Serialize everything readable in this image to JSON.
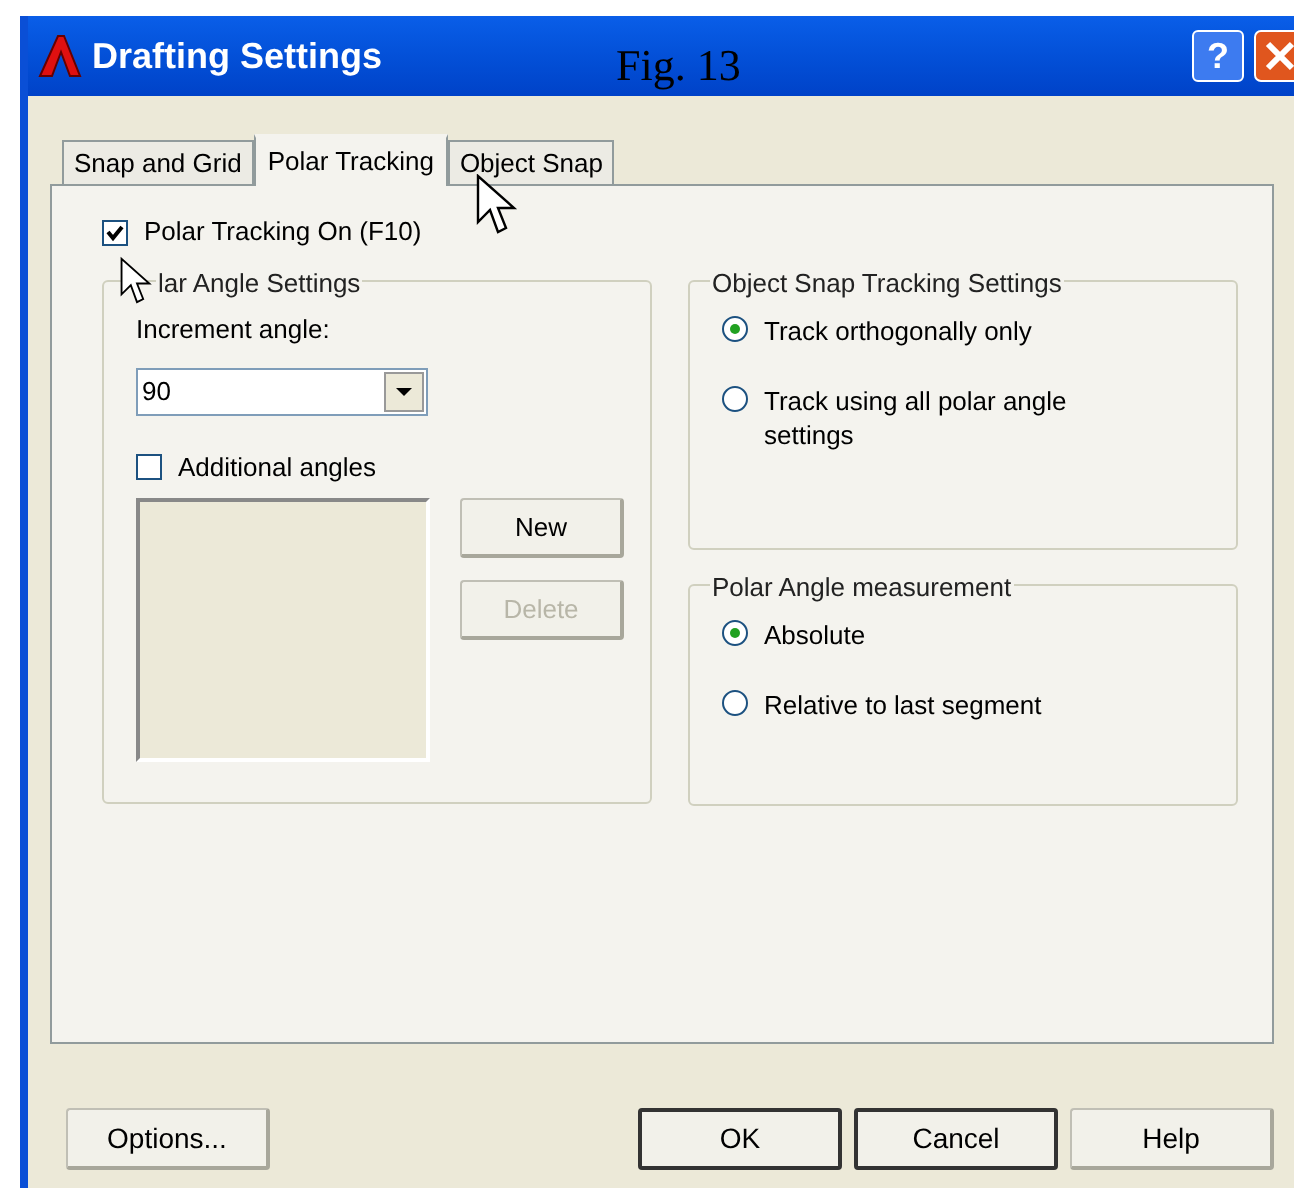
{
  "window": {
    "title": "Drafting Settings",
    "caption": "Fig. 13",
    "help_label": "?"
  },
  "tabs": [
    {
      "label": "Snap and Grid",
      "selected": false
    },
    {
      "label": "Polar Tracking",
      "selected": true
    },
    {
      "label": "Object Snap",
      "selected": false
    }
  ],
  "polar_tracking_on": {
    "label": "Polar Tracking On (F10)",
    "checked": true
  },
  "polar_angle_settings": {
    "legend": "lar Angle Settings",
    "increment_label": "Increment angle:",
    "increment_value": "90",
    "additional_angles": {
      "label": "Additional angles",
      "checked": false
    },
    "buttons": [
      {
        "label": "New",
        "disabled": false
      },
      {
        "label": "Delete",
        "disabled": true
      }
    ]
  },
  "object_snap_tracking": {
    "legend": "Object Snap Tracking Settings",
    "options": [
      {
        "label": "Track orthogonally only",
        "selected": true
      },
      {
        "label": "Track using all polar angle settings",
        "selected": false
      }
    ]
  },
  "polar_angle_measurement": {
    "legend": "Polar Angle measurement",
    "options": [
      {
        "label": "Absolute",
        "selected": true
      },
      {
        "label": "Relative to last segment",
        "selected": false
      }
    ]
  },
  "footer_buttons": [
    {
      "label": "Options...",
      "default": false
    },
    {
      "label": "OK",
      "default": true
    },
    {
      "label": "Cancel",
      "default": true
    },
    {
      "label": "Help",
      "default": false
    }
  ]
}
